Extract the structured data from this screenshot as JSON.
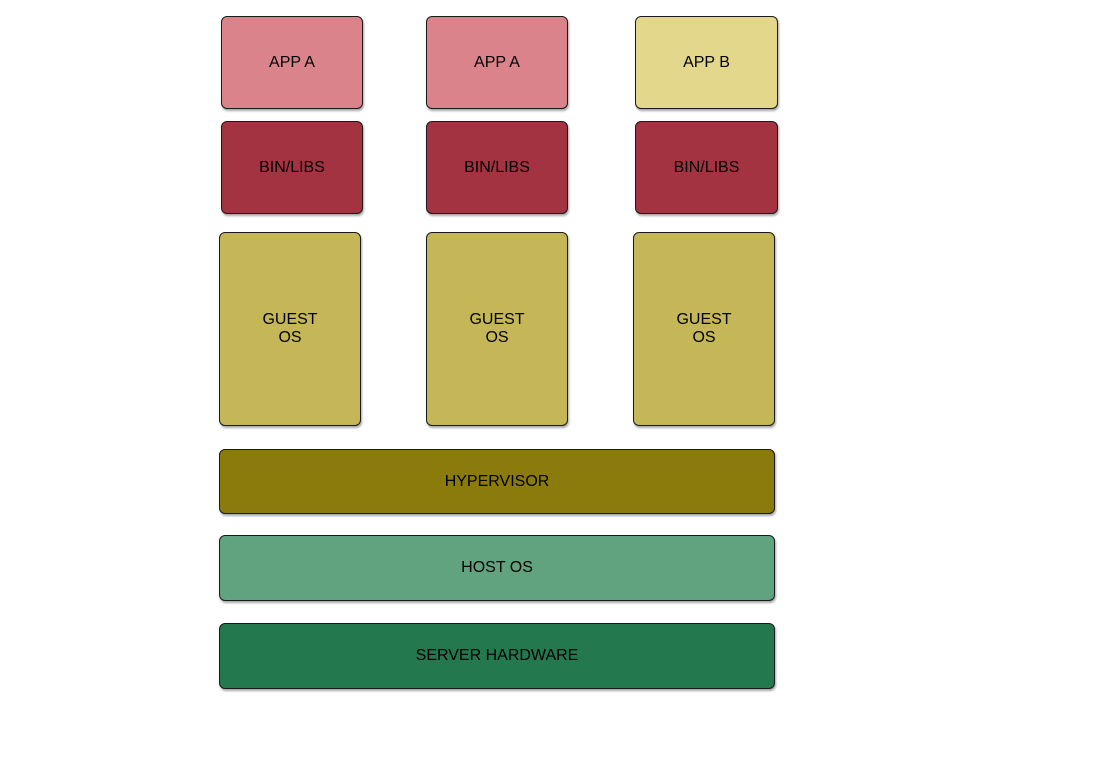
{
  "colors": {
    "app_a": "#da838b",
    "app_b": "#e2d78a",
    "bin_libs": "#a33341",
    "guest_os": "#c5b757",
    "hypervisor": "#8b7b0c",
    "host_os": "#62a37f",
    "server_hardware": "#24784d"
  },
  "apps": [
    {
      "label": "APP A",
      "color_key": "app_a"
    },
    {
      "label": "APP A",
      "color_key": "app_a"
    },
    {
      "label": "APP B",
      "color_key": "app_b"
    }
  ],
  "bin_libs": [
    {
      "label": "BIN/LIBS"
    },
    {
      "label": "BIN/LIBS"
    },
    {
      "label": "BIN/LIBS"
    }
  ],
  "guest_os": [
    {
      "label": "GUEST\nOS"
    },
    {
      "label": "GUEST\nOS"
    },
    {
      "label": "GUEST\nOS"
    }
  ],
  "hypervisor": {
    "label": "HYPERVISOR"
  },
  "host_os": {
    "label": "HOST OS"
  },
  "server_hardware": {
    "label": "SERVER HARDWARE"
  }
}
